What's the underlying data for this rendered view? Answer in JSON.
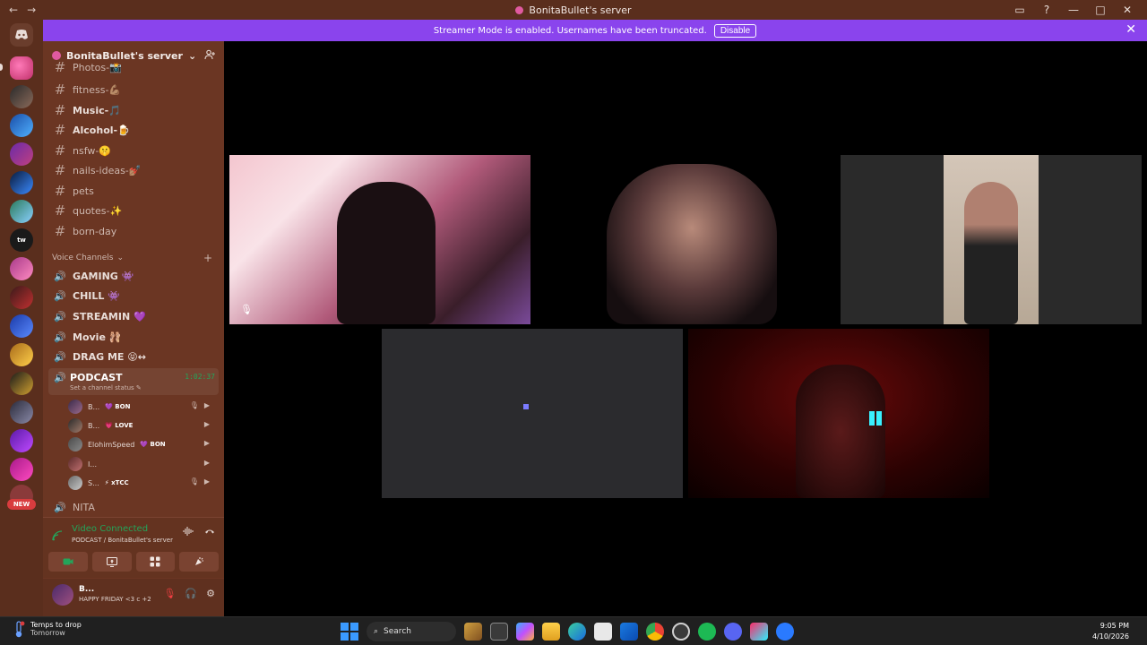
{
  "window": {
    "title": "BonitaBullet's server",
    "nav": [
      "←",
      "→"
    ],
    "controls": [
      "▭",
      "?",
      "—",
      "□",
      "✕"
    ]
  },
  "banner": {
    "text": "Streamer Mode is enabled. Usernames have been truncated.",
    "button": "Disable",
    "close": "✕"
  },
  "server": {
    "name": "BonitaBullet's server",
    "chevron": "⌄"
  },
  "text_channels": [
    {
      "name": "Photos-📸",
      "icon": "hash-icon"
    },
    {
      "name": "fitness-💪🏽",
      "icon": "hash-icon"
    },
    {
      "name": "Music-🎵",
      "icon": "hash-icon",
      "bold": true
    },
    {
      "name": "Alcohol-🍺",
      "icon": "hash-icon",
      "bold": true
    },
    {
      "name": "nsfw-🤫",
      "icon": "hash-icon"
    },
    {
      "name": "nails-ideas-💅🏽",
      "icon": "hash-icon"
    },
    {
      "name": "pets",
      "icon": "hash-icon"
    },
    {
      "name": "quotes-✨",
      "icon": "hash-icon"
    },
    {
      "name": "born-day",
      "icon": "hash-icon"
    }
  ],
  "voice_category": {
    "label": "Voice Channels",
    "plus": "+"
  },
  "voice_channels": [
    {
      "name": "GAMING 👾"
    },
    {
      "name": "CHILL 👾"
    },
    {
      "name": "STREAMIN 💜"
    },
    {
      "name": "Movie 🩰"
    },
    {
      "name": "DRAG ME 😝↔"
    }
  ],
  "podcast": {
    "name": "PODCAST",
    "timer": "1:02:37",
    "status": "Set a channel status ✎",
    "members": [
      {
        "name": "B...",
        "tag": "💜 BON",
        "icons": [
          "🎙",
          "▶"
        ]
      },
      {
        "name": "B...",
        "tag": "💗 LOVE",
        "icons": [
          "▶"
        ]
      },
      {
        "name": "ElohimSpeed",
        "tag": "💜 BON",
        "icons": [
          "▶"
        ]
      },
      {
        "name": "I...",
        "tag": "",
        "icons": [
          "▶"
        ]
      },
      {
        "name": "S...",
        "tag": "⚡ xTCC",
        "icons": [
          "🎙",
          "▶"
        ]
      }
    ]
  },
  "next_channel": {
    "name": "NITA"
  },
  "voice_panel": {
    "status": "Video Connected",
    "location": "PODCAST / BonitaBullet's server",
    "buttons": [
      "cam",
      "screen",
      "activity",
      "soundboard"
    ]
  },
  "user_panel": {
    "name": "B...",
    "status": "HAPPY FRIDAY <3 c +2"
  },
  "rail": {
    "new_label": "NEW"
  },
  "taskbar": {
    "weather_title": "Temps to drop",
    "weather_sub": "Tomorrow",
    "search": "Search",
    "time": "9:05 PM",
    "date": "4/10/2026"
  },
  "colors": {
    "sidebar": "#6b3623",
    "rail": "#5a2e1d",
    "banner": "#8a44ed",
    "voice_green": "#23a55a",
    "muted_red": "#f23f42"
  }
}
